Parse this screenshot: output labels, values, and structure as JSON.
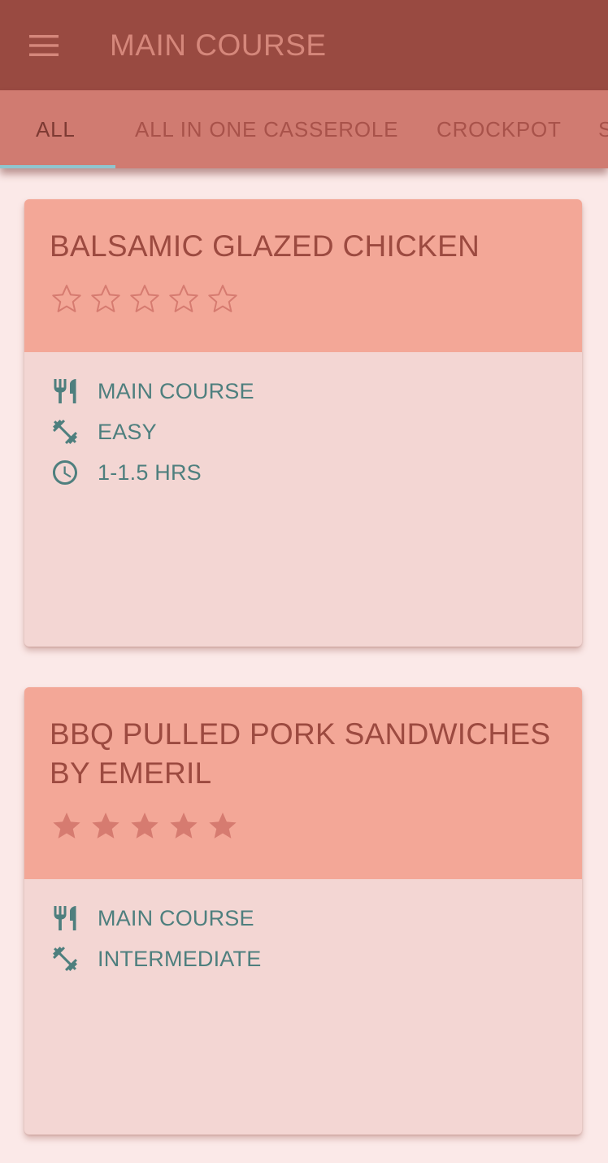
{
  "app_bar": {
    "title": "MAIN COURSE",
    "menu_icon": "hamburger-menu-icon"
  },
  "tabs": [
    {
      "label": "ALL",
      "selected": true
    },
    {
      "label": "ALL IN ONE CASSEROLE",
      "selected": false
    },
    {
      "label": "CROCKPOT",
      "selected": false
    },
    {
      "label": "S",
      "selected": false
    }
  ],
  "recipes": [
    {
      "title": "BALSAMIC GLAZED CHICKEN",
      "rating": 0,
      "rating_max": 5,
      "details": [
        {
          "icon": "fork-knife-icon",
          "text": "MAIN COURSE"
        },
        {
          "icon": "dumbbell-icon",
          "text": "EASY"
        },
        {
          "icon": "clock-icon",
          "text": "1-1.5 HRS"
        }
      ]
    },
    {
      "title": "BBQ PULLED PORK SANDWICHES BY EMERIL",
      "rating": 5,
      "rating_max": 5,
      "details": [
        {
          "icon": "fork-knife-icon",
          "text": "MAIN COURSE"
        },
        {
          "icon": "dumbbell-icon",
          "text": "INTERMEDIATE"
        }
      ]
    }
  ],
  "colors": {
    "app_bar": "#994a41",
    "tab_bar": "#d07b71",
    "tab_indicator": "#8fc6cf",
    "card_header": "#f3a797",
    "card_body": "#f3d6d3",
    "background": "#fbe9e8",
    "detail_text": "#4e7f7e",
    "star": "#d67b70"
  }
}
